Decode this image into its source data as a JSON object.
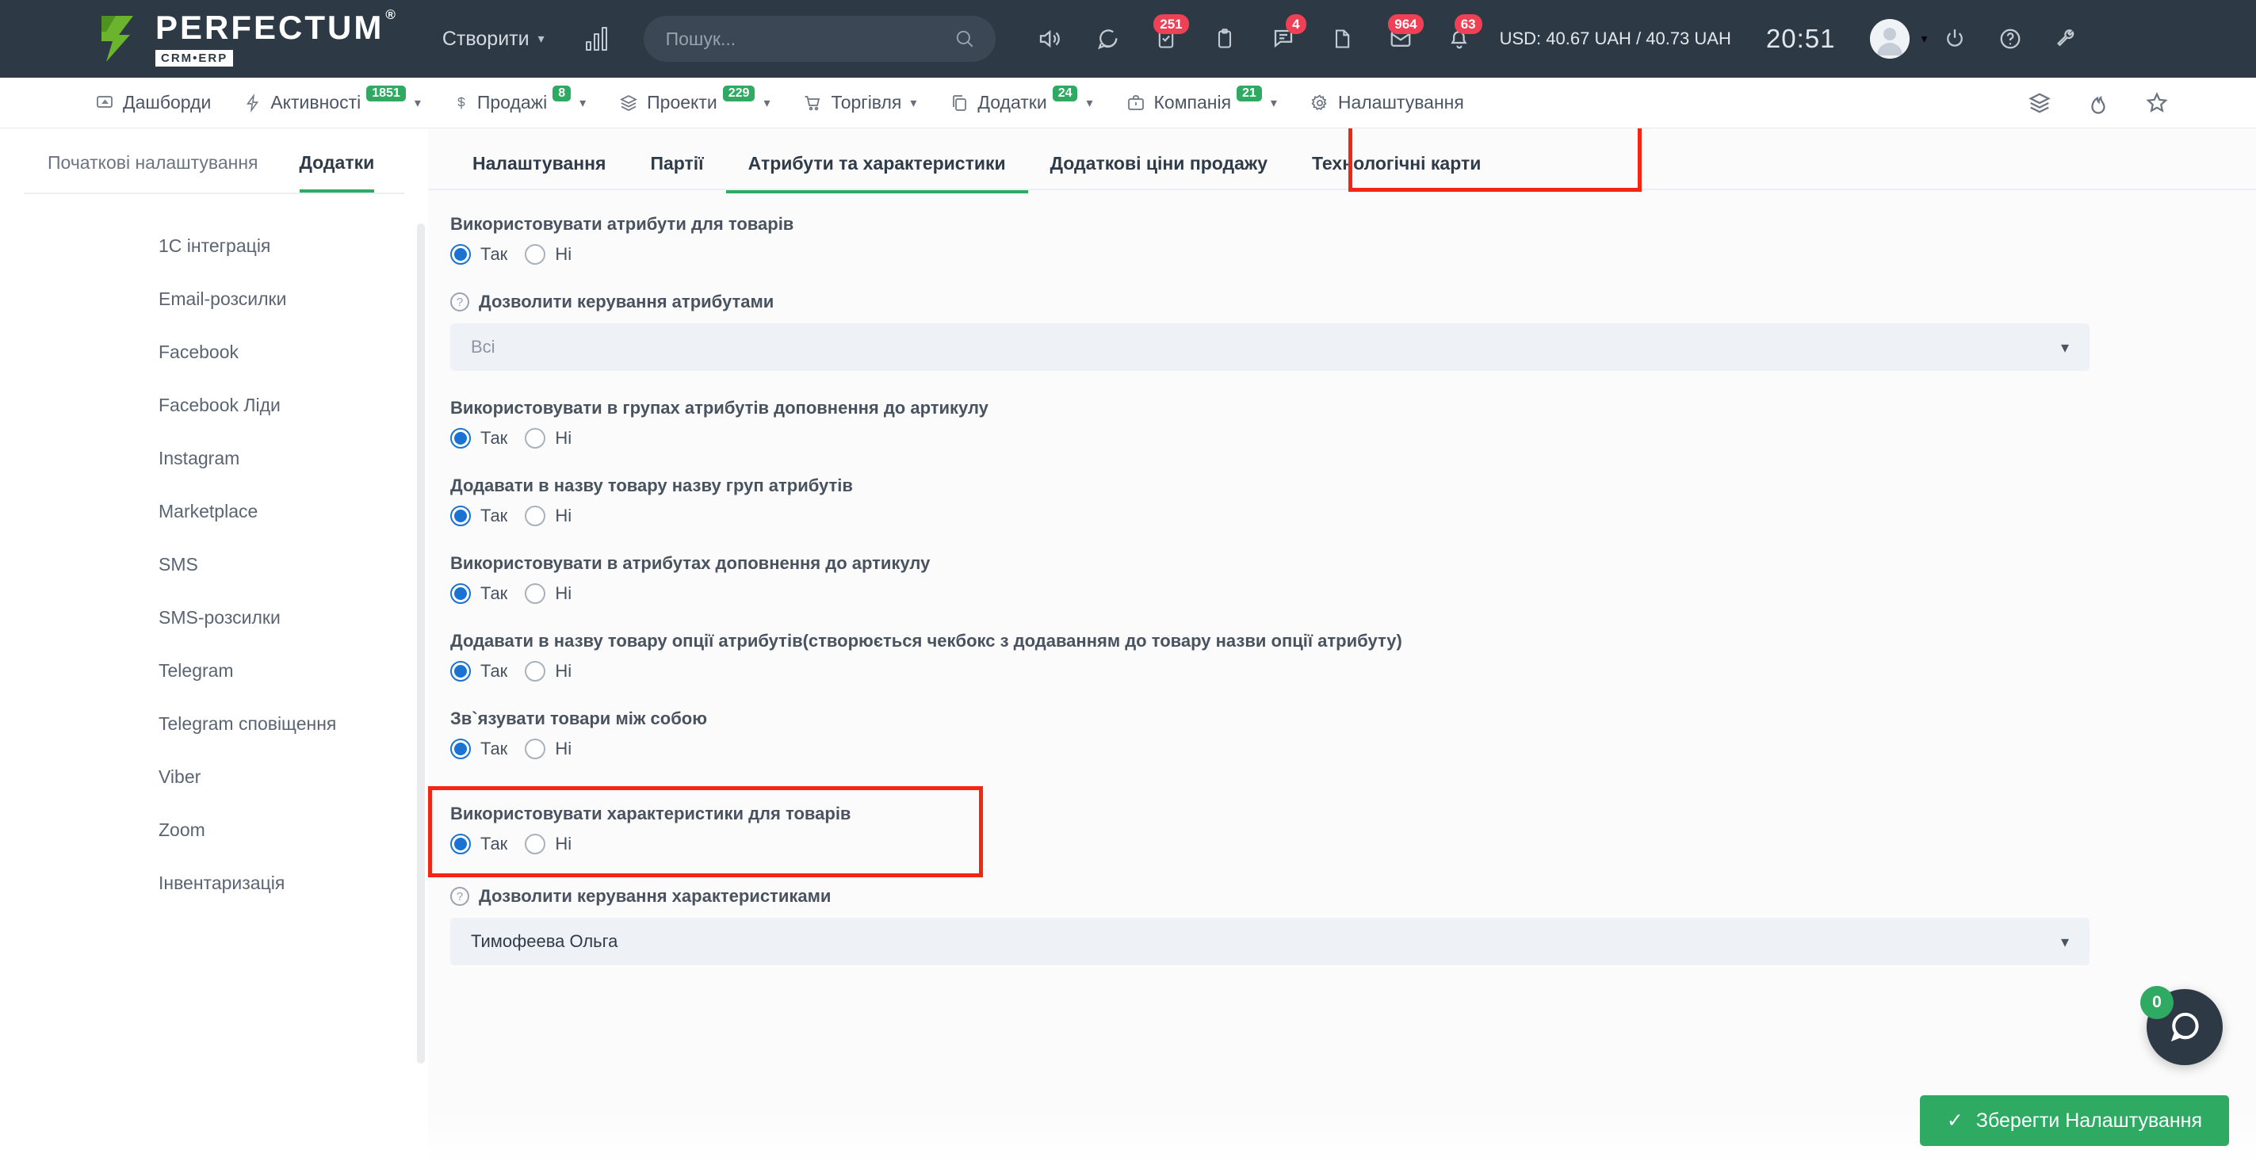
{
  "topbar": {
    "logo_name": "PERFECTUM",
    "logo_reg": "®",
    "logo_sub": "CRM•ERP",
    "create_label": "Створити",
    "search_placeholder": "Пошук...",
    "currency": "USD: 40.67 UAH / 40.73 UAH",
    "currency_value": "USD: 40.67",
    "time": "20:51",
    "icons": [
      {
        "name": "speaker-icon",
        "badge": ""
      },
      {
        "name": "chat-bubble-icon",
        "badge": ""
      },
      {
        "name": "tasks-check-icon",
        "badge": "251"
      },
      {
        "name": "clipboard-icon",
        "badge": ""
      },
      {
        "name": "comment-lines-icon",
        "badge": "4"
      },
      {
        "name": "document-icon",
        "badge": ""
      },
      {
        "name": "envelope-icon",
        "badge": "964"
      },
      {
        "name": "notification-bell-icon",
        "badge": "63"
      }
    ],
    "right_icons": [
      "power-icon",
      "help-icon",
      "wrench-icon"
    ]
  },
  "navbar": {
    "items": [
      {
        "label": "Дашборди",
        "badge": "",
        "caret": false,
        "icon": "dashboard-icon"
      },
      {
        "label": "Активності",
        "badge": "1851",
        "caret": true,
        "icon": "activity-bolt-icon"
      },
      {
        "label": "Продажі",
        "badge": "8",
        "caret": true,
        "icon": "dollar-icon"
      },
      {
        "label": "Проекти",
        "badge": "229",
        "caret": true,
        "icon": "projects-layers-icon"
      },
      {
        "label": "Торгівля",
        "badge": "",
        "caret": true,
        "icon": "cart-icon"
      },
      {
        "label": "Додатки",
        "badge": "24",
        "caret": true,
        "icon": "apps-copy-icon"
      },
      {
        "label": "Компанія",
        "badge": "21",
        "caret": true,
        "icon": "briefcase-icon"
      },
      {
        "label": "Налаштування",
        "badge": "",
        "caret": false,
        "icon": "gear-icon"
      }
    ],
    "right_icons": [
      "layers-icon",
      "fire-icon",
      "star-icon"
    ]
  },
  "sidebar": {
    "tabs": [
      {
        "label": "Початкові налаштування",
        "active": false
      },
      {
        "label": "Додатки",
        "active": true
      }
    ],
    "items": [
      {
        "label": "1C інтеграція"
      },
      {
        "label": "Email-розсилки"
      },
      {
        "label": "Facebook"
      },
      {
        "label": "Facebook Ліди"
      },
      {
        "label": "Instagram"
      },
      {
        "label": "Marketplace"
      },
      {
        "label": "SMS"
      },
      {
        "label": "SMS-розсилки"
      },
      {
        "label": "Telegram"
      },
      {
        "label": "Telegram сповіщення"
      },
      {
        "label": "Viber"
      },
      {
        "label": "Zoom"
      },
      {
        "label": "Інвентаризація"
      }
    ]
  },
  "main": {
    "tabs": [
      {
        "label": "Налаштування",
        "active": false
      },
      {
        "label": "Партії",
        "active": false
      },
      {
        "label": "Атрибути та характеристики",
        "active": true
      },
      {
        "label": "Додаткові ціни продажу",
        "active": false
      },
      {
        "label": "Технологічні карти",
        "active": false
      }
    ],
    "radio_yes": "Так",
    "radio_no": "Ні",
    "fields": {
      "use_attributes": {
        "label": "Використовувати атрибути для товарів",
        "value": "Так"
      },
      "allow_manage_attributes": {
        "label": "Дозволити керування атрибутами",
        "value": "Всі"
      },
      "group_article_suffix": {
        "label": "Використовувати в групах атрибутів доповнення до артикулу",
        "value": "Так"
      },
      "add_group_name": {
        "label": "Додавати в назву товару назву груп атрибутів",
        "value": "Так"
      },
      "attr_article_suffix": {
        "label": "Використовувати в атрибутах доповнення до артикулу",
        "value": "Так"
      },
      "add_option_name": {
        "label": "Додавати в назву товару опції атрибутів(створюється чекбокс з додаванням до товару назви опції атрибуту)",
        "value": "Так"
      },
      "link_products": {
        "label": "Зв`язувати товари між собою",
        "value": "Так"
      },
      "use_characteristics": {
        "label": "Використовувати характеристики для товарів",
        "value": "Так"
      },
      "allow_manage_characteristics": {
        "label": "Дозволити керування характеристиками",
        "value": "Тимофеева Ольга"
      }
    }
  },
  "footer": {
    "save_label": "Зберегти Налаштування",
    "save_check": "✓",
    "chat_badge": "0"
  },
  "colors": {
    "accent_green": "#2eaa63",
    "topbar_bg": "#2d3a46",
    "badge_red": "#ef4056",
    "radio_blue": "#1a73d2",
    "highlight_red": "#f22613"
  }
}
